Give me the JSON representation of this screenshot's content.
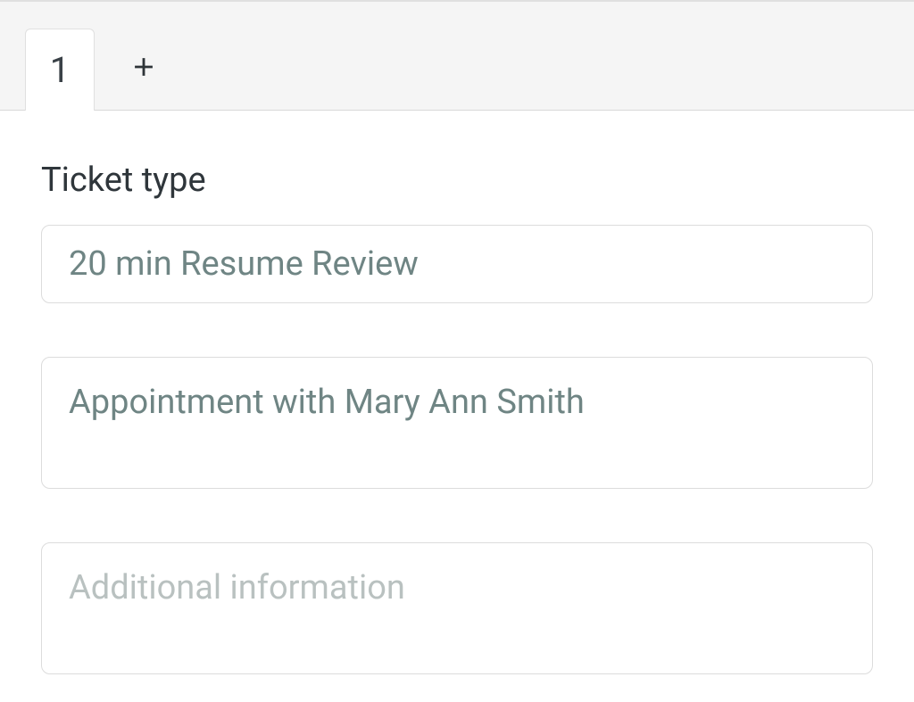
{
  "tabs": {
    "items": [
      {
        "label": "1"
      }
    ]
  },
  "form": {
    "section_label": "Ticket type",
    "ticket_type_value": "20 min Resume Review",
    "appointment_value": "Appointment with Mary Ann Smith",
    "additional_info_placeholder": "Additional information",
    "additional_info_value": ""
  }
}
